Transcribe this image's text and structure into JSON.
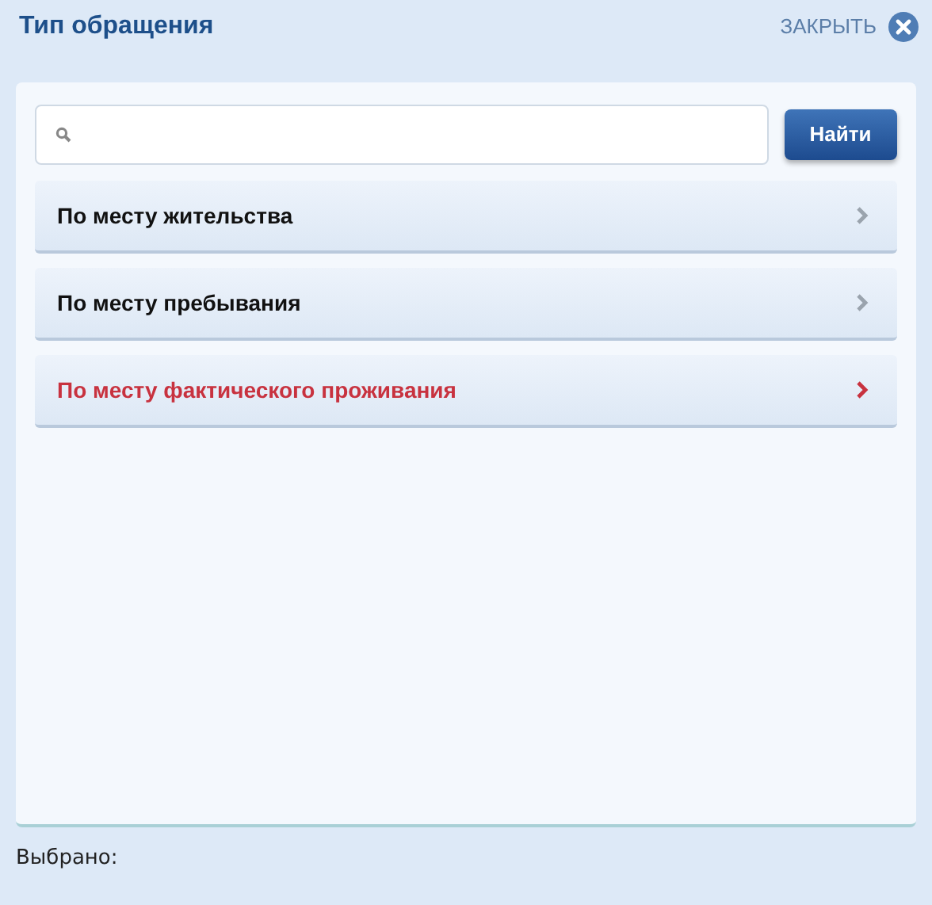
{
  "window": {
    "title": "Тип обращения",
    "close_label": "ЗАКРЫТЬ"
  },
  "search": {
    "button": "Найти"
  },
  "items": [
    {
      "label": "По месту жительства",
      "selected": false
    },
    {
      "label": "По месту пребывания",
      "selected": false
    },
    {
      "label": "По месту фактического проживания",
      "selected": true
    }
  ],
  "footer": {
    "label": "Выбрано:"
  }
}
